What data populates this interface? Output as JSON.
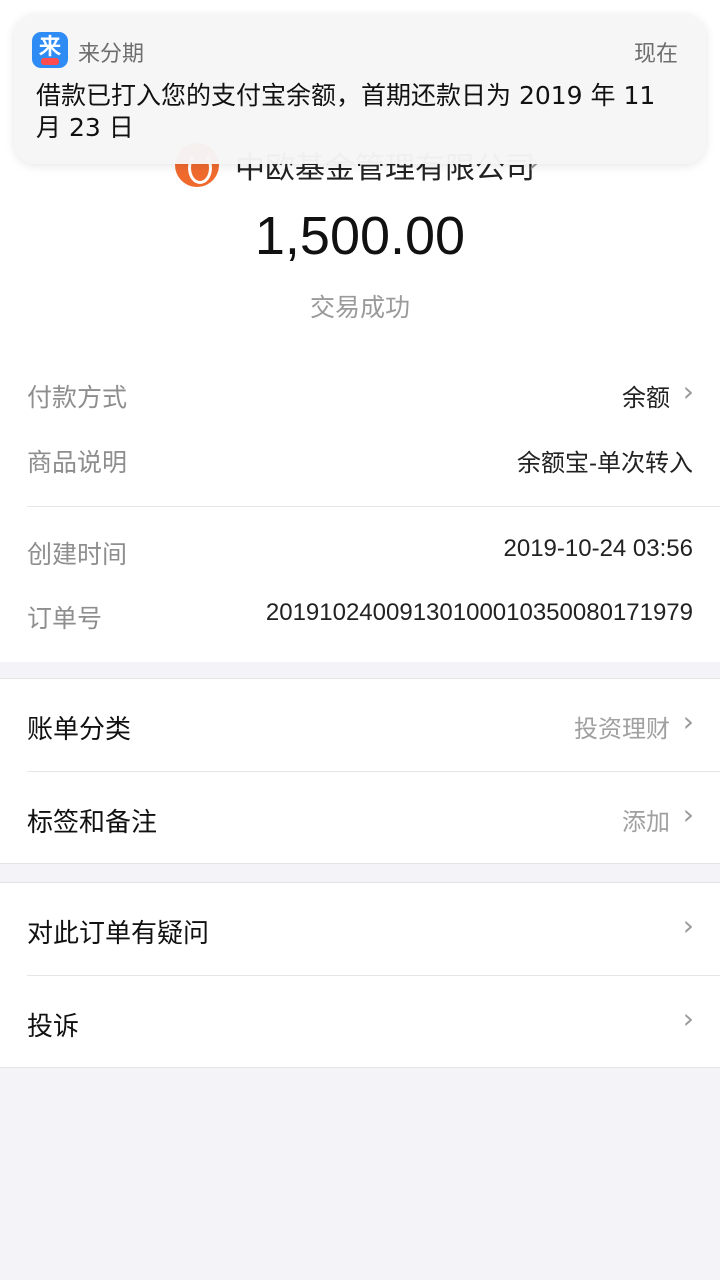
{
  "notification": {
    "app_name": "来分期",
    "icon_glyph": "来",
    "time": "现在",
    "message": "借款已打入您的支付宝余额，首期还款日为 2019 年 11 月 23 日"
  },
  "merchant": {
    "name": "中欧基金管理有限公司",
    "chevron": "›"
  },
  "transaction": {
    "amount": "1,500.00",
    "status": "交易成功"
  },
  "details": {
    "payment_method_label": "付款方式",
    "payment_method_value": "余额",
    "product_label": "商品说明",
    "product_value": "余额宝-单次转入",
    "created_label": "创建时间",
    "created_value": "2019-10-24 03:56",
    "order_label": "订单号",
    "order_value": "20191024009130100010350080171979"
  },
  "bill_settings": {
    "category_label": "账单分类",
    "category_value": "投资理财",
    "tags_label": "标签和备注",
    "tags_value": "添加"
  },
  "support": {
    "question_label": "对此订单有疑问",
    "complaint_label": "投诉"
  },
  "colors": {
    "background": "#f4f4f8",
    "merchant_logo": "#f06a2d",
    "notification_icon": "#2f8cf5"
  }
}
